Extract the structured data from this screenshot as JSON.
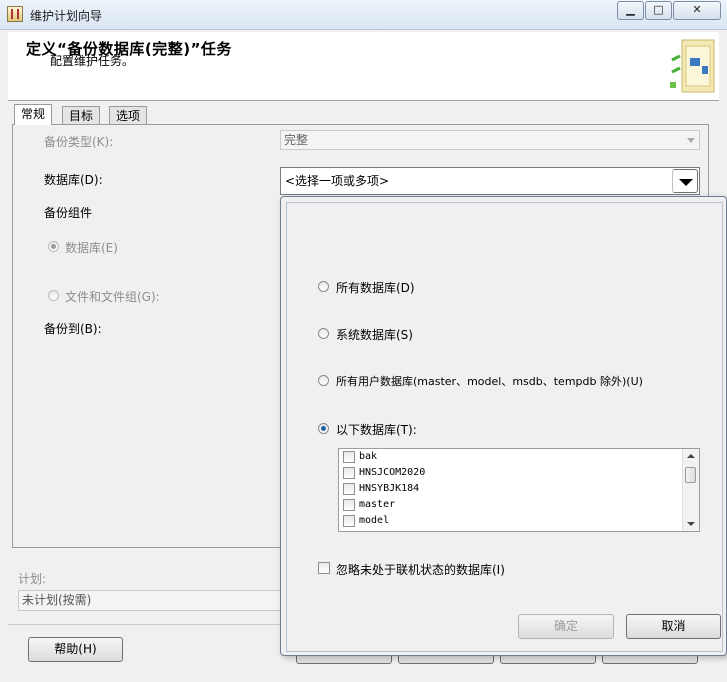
{
  "window": {
    "title": "维护计划向导",
    "minimize_glyph": "▁",
    "maximize_glyph": "□",
    "close_glyph": "✕"
  },
  "header": {
    "title": "定义“备份数据库(完整)”任务",
    "subtitle": "配置维护任务。"
  },
  "tabs": [
    {
      "label": "常规",
      "active": true
    },
    {
      "label": "目标",
      "active": false
    },
    {
      "label": "选项",
      "active": false
    }
  ],
  "general": {
    "backup_type_label": "备份类型(K):",
    "backup_type_value": "完整",
    "database_label": "数据库(D):",
    "database_value": "<选择一项或多项>",
    "backup_component_label": "备份组件",
    "radio_database_label": "数据库(E)",
    "radio_files_label": "文件和文件组(G):",
    "backup_to_label": "备份到(B):"
  },
  "schedule": {
    "label": "计划:",
    "value": "未计划(按需)"
  },
  "footer": {
    "help_label": "帮助(H)"
  },
  "popup": {
    "options": [
      {
        "label": "所有数据库(D)",
        "selected": false
      },
      {
        "label": "系统数据库(S)",
        "selected": false
      },
      {
        "label": "所有用户数据库(master、model、msdb、tempdb 除外)(U)",
        "selected": false
      },
      {
        "label": "以下数据库(T):",
        "selected": true
      }
    ],
    "databases": [
      "bak",
      "HNSJCOM2020",
      "HNSYBJK184",
      "master",
      "model"
    ],
    "ignore_offline_label": "忽略未处于联机状态的数据库(I)",
    "ok_label": "确定",
    "cancel_label": "取消"
  }
}
